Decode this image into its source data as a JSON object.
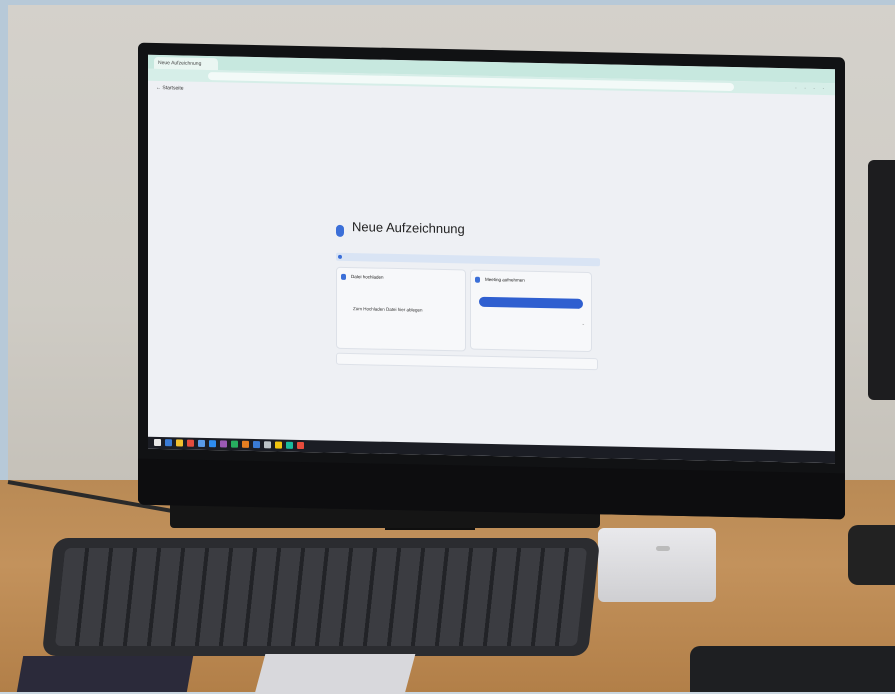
{
  "browser": {
    "tab_title": "Neue Aufzeichnung",
    "address": "",
    "menu_dots": "· · · ·",
    "breadcrumb": "←  Startseite"
  },
  "page": {
    "title": "Neue Aufzeichnung",
    "subtitle": "",
    "info_banner": ""
  },
  "left_card": {
    "title": "Datei hochladen",
    "subtitle": "",
    "drop_text": "Zum Hochladen Datei hier ablegen",
    "drop_sub": ""
  },
  "right_card": {
    "title": "Meeting aufnehmen",
    "subtitle": "",
    "button_label": "",
    "select_label": "",
    "chevron": "⌄"
  },
  "bottom_field": {
    "label": ""
  },
  "taskbar": {
    "time": "",
    "icon_colors": [
      "#e8e8e8",
      "#3a7bd5",
      "#f2c12e",
      "#e34c3d",
      "#5a9be8",
      "#2d8cf0",
      "#9b59b6",
      "#27ae60",
      "#e67e22",
      "#3a7bd5",
      "#bdc3c7",
      "#f1c40f",
      "#1abc9c",
      "#e74c3c"
    ]
  },
  "colors": {
    "accent": "#2f5fd0",
    "browser_chrome": "#c7e8df"
  }
}
